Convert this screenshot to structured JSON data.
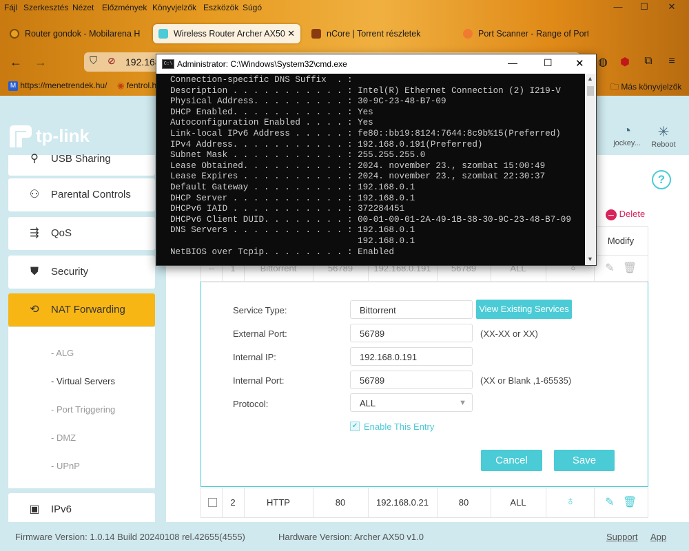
{
  "browser": {
    "menu": [
      "Fájl",
      "Szerkesztés",
      "Nézet",
      "Előzmények",
      "Könyvjelzők",
      "Eszközök",
      "Súgó"
    ],
    "tabs": [
      {
        "label": "Router gondok - Mobilarena H",
        "icon_color": "#e8a020"
      },
      {
        "label": "Wireless Router Archer AX50",
        "icon_color": "#4acbd6"
      },
      {
        "label": "nCore | Torrent részletek",
        "icon_color": "#8a3a10"
      },
      {
        "label": "Port Scanner - Range of Ports -",
        "icon_color": "#f07a30"
      }
    ],
    "url": "192.168",
    "bookmarks": [
      "https://menetrendek.hu/",
      "fentrol.h"
    ],
    "other_bookmarks": "Más könyvjelzők"
  },
  "cmd": {
    "title": "Administrator: C:\\Windows\\System32\\cmd.exe",
    "lines": [
      "Connection-specific DNS Suffix  . :",
      "Description . . . . . . . . . . . : Intel(R) Ethernet Connection (2) I219-V",
      "Physical Address. . . . . . . . . : 30-9C-23-48-B7-09",
      "DHCP Enabled. . . . . . . . . . . : Yes",
      "Autoconfiguration Enabled . . . . : Yes",
      "Link-local IPv6 Address . . . . . : fe80::bb19:8124:7644:8c9b%15(Preferred)",
      "IPv4 Address. . . . . . . . . . . : 192.168.0.191(Preferred)",
      "Subnet Mask . . . . . . . . . . . : 255.255.255.0",
      "Lease Obtained. . . . . . . . . . : 2024. november 23., szombat 15:00:49",
      "Lease Expires . . . . . . . . . . : 2024. november 23., szombat 22:30:37",
      "Default Gateway . . . . . . . . . : 192.168.0.1",
      "DHCP Server . . . . . . . . . . . : 192.168.0.1",
      "DHCPv6 IAID . . . . . . . . . . . : 372284451",
      "DHCPv6 Client DUID. . . . . . . . : 00-01-00-01-2A-49-1B-38-30-9C-23-48-B7-09",
      "DNS Servers . . . . . . . . . . . : 192.168.0.1",
      "                                    192.168.0.1",
      "NetBIOS over Tcpip. . . . . . . . : Enabled"
    ]
  },
  "router": {
    "brand": "tp-link",
    "header": {
      "user": "jockey...",
      "reboot": "Reboot"
    },
    "sidebar": {
      "usb": "USB Sharing",
      "parental": "Parental Controls",
      "qos": "QoS",
      "security": "Security",
      "nat": "NAT Forwarding",
      "sub": [
        "ALG",
        "Virtual Servers",
        "Port Triggering",
        "DMZ",
        "UPnP"
      ],
      "ipv6": "IPv6"
    },
    "actions": {
      "delete": "Delete",
      "modify": "Modify"
    },
    "rows": [
      {
        "sel": "--",
        "id": "1",
        "service": "Bittorrent",
        "ext": "56789",
        "ip": "192.168.0.191",
        "int": "56789",
        "proto": "ALL"
      },
      {
        "sel": "",
        "id": "2",
        "service": "HTTP",
        "ext": "80",
        "ip": "192.168.0.21",
        "int": "80",
        "proto": "ALL"
      }
    ],
    "form": {
      "service_type_label": "Service Type:",
      "service_type": "Bittorrent",
      "view_existing": "View Existing Services",
      "external_port_label": "External Port:",
      "external_port": "56789",
      "external_hint": "(XX-XX or XX)",
      "internal_ip_label": "Internal IP:",
      "internal_ip": "192.168.0.191",
      "internal_port_label": "Internal Port:",
      "internal_port": "56789",
      "internal_hint": "(XX or Blank ,1-65535)",
      "protocol_label": "Protocol:",
      "protocol": "ALL",
      "enable_label": "Enable This Entry",
      "cancel": "Cancel",
      "save": "Save"
    },
    "footer": {
      "firmware": "Firmware Version: 1.0.14 Build 20240108 rel.42655(4555)",
      "hardware": "Hardware Version: Archer AX50 v1.0",
      "support": "Support",
      "app": "App"
    },
    "colors": {
      "teal": "#4acbd6",
      "yellow": "#f7b614",
      "delete_red": "#d8245a"
    }
  }
}
